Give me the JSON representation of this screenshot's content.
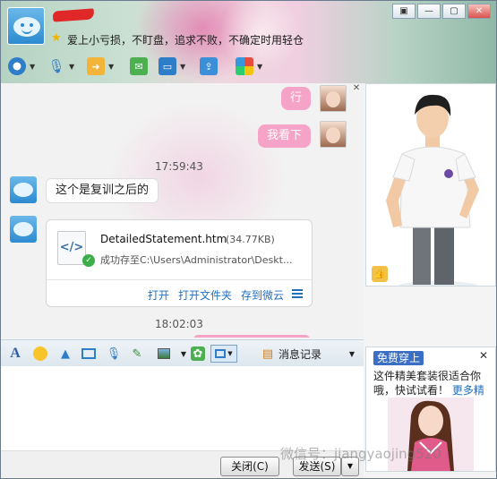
{
  "header": {
    "signature": "爱上小亏损，不盯盘，追求不败，不确定时用轻仓"
  },
  "window_controls": [
    "▣",
    "—",
    "▢",
    "✕"
  ],
  "chat": {
    "messages_right": [
      "行",
      "我看下"
    ],
    "timestamp1": "17:59:43",
    "message_left": "这个是复训之后的",
    "timestamp2": "18:02:03",
    "file": {
      "icon_text": "</>",
      "name": "DetailedStatement.htm",
      "size": "(34.77KB)",
      "path": "成功存至C:\\Users\\Administrator\\Deskt...",
      "action_open": "打开",
      "action_open_folder": "打开文件夹",
      "action_save_cloud": "存到微云"
    }
  },
  "format_bar": {
    "history_label": "消息记录"
  },
  "ad": {
    "badge": "免费穿上",
    "close": "✕",
    "text": "这件精美套装很适合你哦，快试试看！",
    "link": "更多精"
  },
  "buttons": {
    "close": "关闭(C)",
    "send": "发送(S)"
  },
  "watermark": "微信号：jiangyaojing520"
}
